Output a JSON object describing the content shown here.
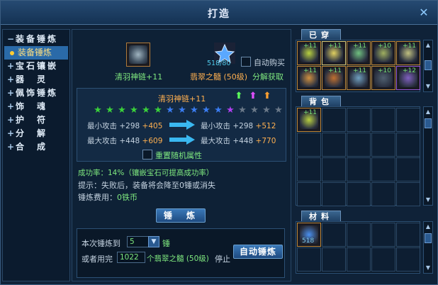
{
  "window": {
    "title": "打造"
  },
  "nav": {
    "groups": [
      {
        "label": "装备锤炼",
        "sym": "−"
      },
      {
        "label": "装备锤炼",
        "sym": "",
        "sub": true
      },
      {
        "label": "宝石镶嵌",
        "sym": "+"
      },
      {
        "label": "器　灵",
        "sym": "+"
      },
      {
        "label": "佩饰锤炼",
        "sym": "+"
      },
      {
        "label": "饰　魂",
        "sym": "+"
      },
      {
        "label": "护　符",
        "sym": "+"
      },
      {
        "label": "分　解",
        "sym": "+"
      },
      {
        "label": "合　成",
        "sym": "+"
      }
    ]
  },
  "forge": {
    "item_name": "清羽神链+11",
    "material_count": "518/80",
    "material_name": "翡翠之髓 (50级)",
    "auto_buy_label": "自动购买",
    "decompose_link": "分解获取",
    "panel_item_name": "清羽神链+11",
    "stars_filled_green": 6,
    "stars_filled_blue": 5,
    "stars_filled_purple": 1,
    "stars_empty": 4,
    "stats": {
      "min_label": "最小攻击",
      "max_label": "最大攻击",
      "min_base": "+298",
      "min_bonus": "+405",
      "max_base": "+448",
      "max_bonus": "+609",
      "min_base_new": "+298",
      "min_bonus_new": "+512",
      "max_base_new": "+448",
      "max_bonus_new": "+770"
    },
    "reset_random_label": "重置随机属性",
    "success_rate": "成功率：14%（镶嵌宝石可提高成功率）",
    "hint": "提示：失败后，装备将会降至0锤或消失",
    "cost_label": "锤炼费用：",
    "cost_value": "0铁币",
    "forge_button": "锤　炼",
    "auto": {
      "label_until": "本次锤炼到",
      "target_value": "5",
      "unit": "锤",
      "or_use_label": "或者用完",
      "use_value": "1022",
      "use_unit": "个翡翠之髓 (50级)",
      "stop_label": "停止",
      "auto_button": "自动锤炼"
    }
  },
  "right": {
    "equipped_tab": "已穿",
    "equipped_counts": [
      "+11",
      "+11",
      "+11",
      "+10",
      "+11",
      "+11",
      "+11",
      "+11",
      "+10",
      "+12"
    ],
    "backpack_tab": "背包",
    "backpack_counts": [
      "+11"
    ],
    "materials_tab": "材料",
    "materials_counts": [
      "518"
    ]
  }
}
